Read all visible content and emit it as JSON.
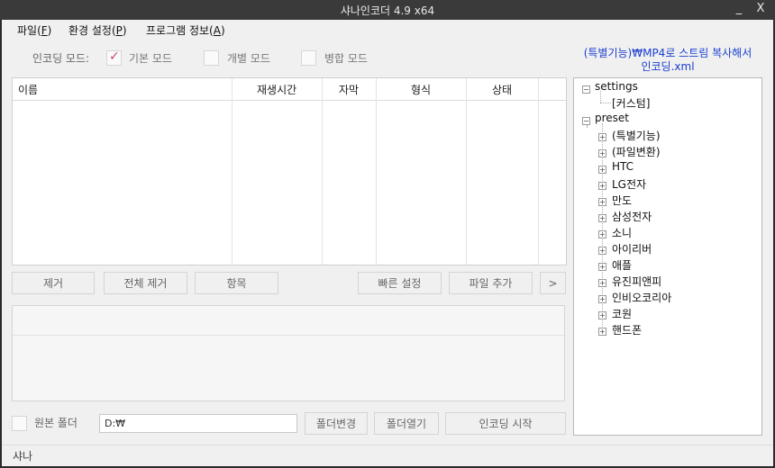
{
  "window": {
    "title": "샤나인코더  4.9  x64",
    "minimize": "_",
    "close": "X"
  },
  "menu": [
    {
      "label": "파일(",
      "key": "F",
      "suffix": ")"
    },
    {
      "label": "환경 설정(",
      "key": "P",
      "suffix": ")"
    },
    {
      "label": "프로그램 정보(",
      "key": "A",
      "suffix": ")"
    }
  ],
  "encoding_mode": {
    "label": "인코딩 모드:",
    "options": [
      {
        "label": "기본 모드",
        "checked": true
      },
      {
        "label": "개별 모드",
        "checked": false
      },
      {
        "label": "병합 모드",
        "checked": false
      }
    ]
  },
  "preset_title": {
    "line1": "(특별기능)₩MP4로 스트림 복사해서",
    "line2": "인코딩.xml"
  },
  "file_list": {
    "columns": [
      "이름",
      "재생시간",
      "자막",
      "형식",
      "상태"
    ],
    "rows": []
  },
  "actions": {
    "remove": "제거",
    "remove_all": "전체 제거",
    "items": "항목",
    "quick_settings": "빠른 설정",
    "add_file": "파일 추가",
    "more": ">"
  },
  "output": {
    "source_folder_label": "원본 폴더",
    "source_folder_checked": false,
    "path": "D:₩",
    "change_folder": "폴더변경",
    "open_folder": "폴더열기",
    "start": "인코딩 시작"
  },
  "tree": {
    "settings": {
      "label": "settings",
      "children": [
        "[커스텀]"
      ]
    },
    "preset": {
      "label": "preset",
      "children": [
        "(특별기능)",
        "(파일변환)",
        "HTC",
        "LG전자",
        "만도",
        "삼성전자",
        "소니",
        "아이리버",
        "애플",
        "유진피앤피",
        "인비오코리아",
        "코원",
        "핸드폰"
      ]
    }
  },
  "status": {
    "text": "샤나"
  },
  "colors": {
    "accent_link": "#1a3fcf",
    "check_mark": "#d0407a",
    "titlebar": "#3a3a3a"
  },
  "icons": {
    "check_mark": "checkmark-icon",
    "tree_expand": "plus-box-icon",
    "tree_collapse": "minus-box-icon"
  }
}
